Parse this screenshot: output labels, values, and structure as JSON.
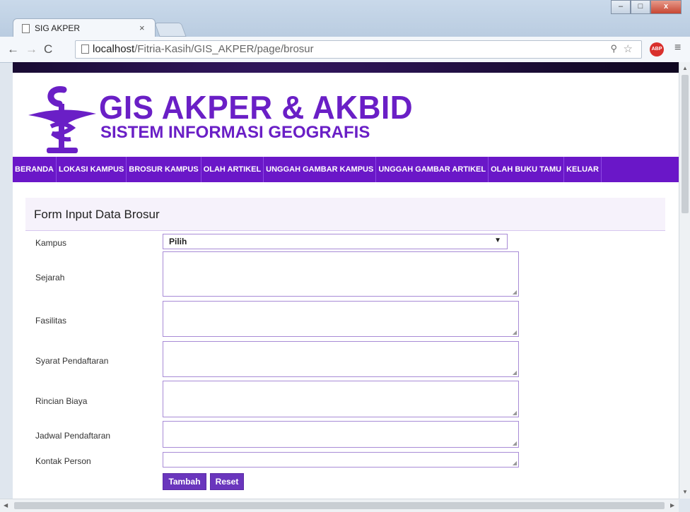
{
  "browser": {
    "tab_title": "SIG AKPER",
    "tab_close": "×",
    "url_host": "localhost",
    "url_path": "/Fitria-Kasih/GIS_AKPER/page/brosur",
    "abp": "ABP",
    "window_minimize": "–",
    "window_maximize": "□",
    "window_close": "x"
  },
  "site": {
    "title": "GIS AKPER & AKBID",
    "subtitle": "SISTEM INFORMASI GEOGRAFIS"
  },
  "nav": {
    "items": [
      "BERANDA",
      "LOKASI KAMPUS",
      "BROSUR KAMPUS",
      "OLAH ARTIKEL",
      "UNGGAH GAMBAR KAMPUS",
      "UNGGAH GAMBAR ARTIKEL",
      "OLAH BUKU TAMU",
      "KELUAR"
    ]
  },
  "form": {
    "title": "Form Input Data Brosur",
    "kampus_label": "Kampus",
    "kampus_value": "Pilih",
    "sejarah_label": "Sejarah",
    "fasilitas_label": "Fasilitas",
    "syarat_label": "Syarat Pendaftaran",
    "rincian_label": "Rincian Biaya",
    "jadwal_label": "Jadwal Pendaftaran",
    "kontak_label": "Kontak Person",
    "submit_label": "Tambah",
    "reset_label": "Reset"
  },
  "colors": {
    "brand_purple": "#6a1fc6",
    "nav_bg": "#6a17c8",
    "button_bg": "#6a36bd"
  }
}
